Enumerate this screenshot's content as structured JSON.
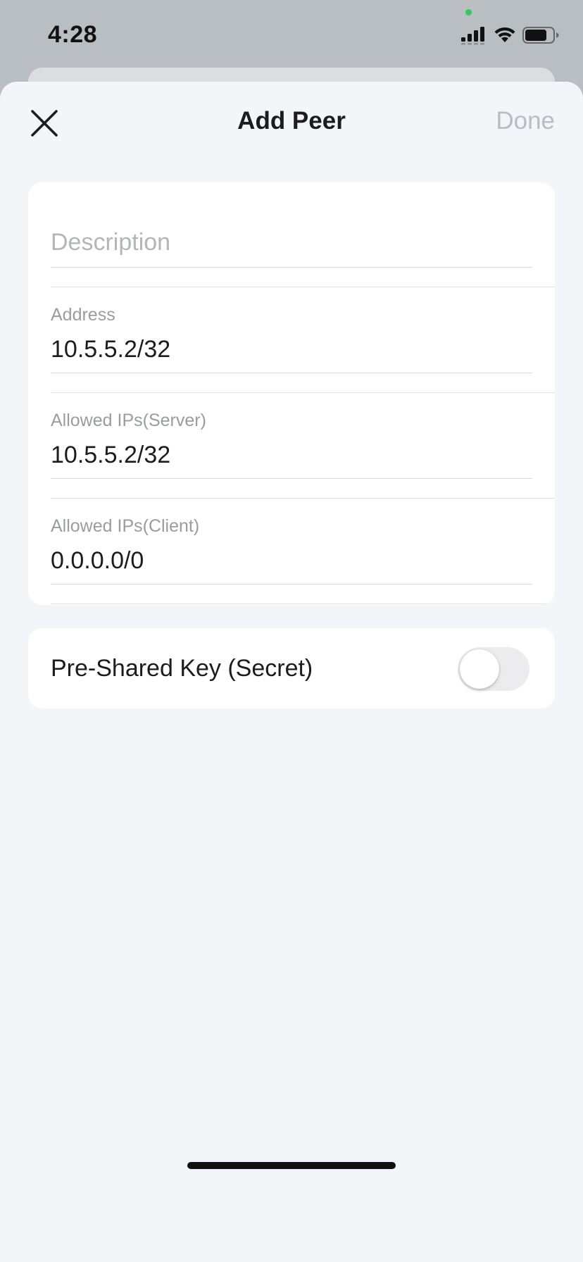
{
  "status_bar": {
    "time": "4:28"
  },
  "nav": {
    "title": "Add Peer",
    "done_label": "Done",
    "close_icon": "close-icon"
  },
  "form": {
    "description": {
      "placeholder": "Description",
      "value": ""
    },
    "address": {
      "label": "Address",
      "value": "10.5.5.2/32"
    },
    "allowed_ips_server": {
      "label": "Allowed IPs(Server)",
      "value": "10.5.5.2/32"
    },
    "allowed_ips_client": {
      "label": "Allowed IPs(Client)",
      "value": "0.0.0.0/0"
    }
  },
  "psk": {
    "label": "Pre-Shared Key (Secret)",
    "enabled": false
  },
  "colors": {
    "sheet_background": "#f4f5f9",
    "card_background": "#ffffff",
    "disabled_text": "#b9bcc2",
    "label_text": "#9a9ca2"
  }
}
